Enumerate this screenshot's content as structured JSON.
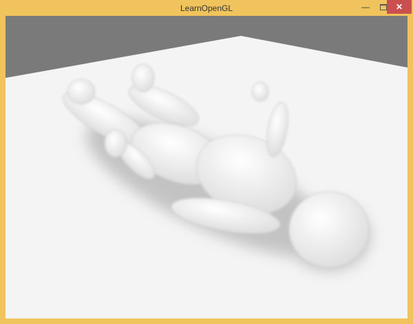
{
  "window": {
    "title": "LearnOpenGL",
    "minimize_icon": "minimize-icon",
    "maximize_icon": "maximize-icon",
    "close_icon": "close-icon",
    "border_color": "#f0c35c",
    "close_color": "#c9504f"
  },
  "scene": {
    "background_color": "#7a7a7a",
    "plane_color": "#f4f4f4"
  }
}
